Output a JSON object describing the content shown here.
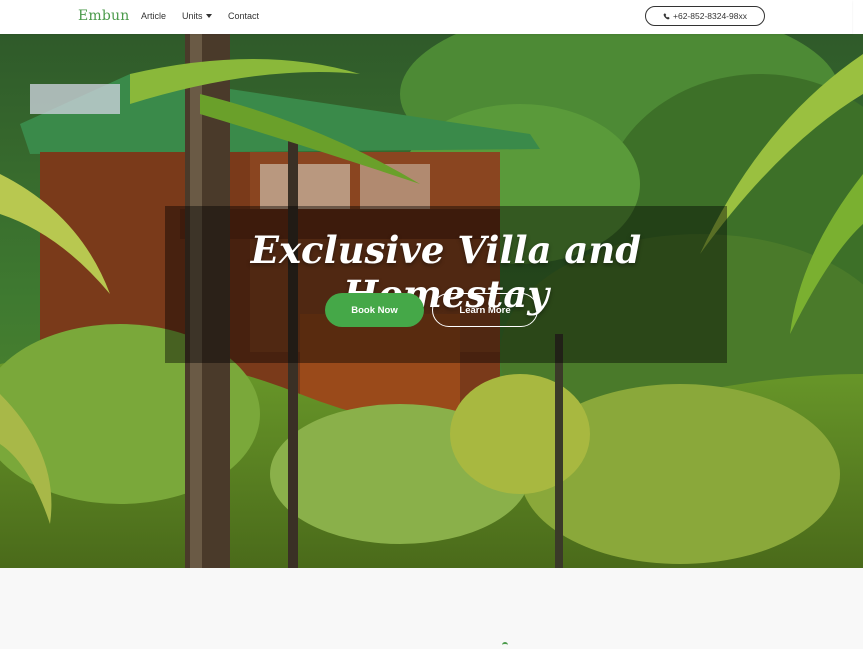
{
  "navbar": {
    "brand": "Embun",
    "links": [
      {
        "label": "Article"
      },
      {
        "label": "Units",
        "has_dropdown": true
      },
      {
        "label": "Contact"
      }
    ],
    "phone": {
      "label": "+62-852-8324-98xx",
      "icon": "phone-icon"
    }
  },
  "hero": {
    "title": "Exclusive Villa and Homestay",
    "primary_button": "Book Now",
    "secondary_button": "Learn More",
    "background_image": "tropical-villa-jungle-photo"
  },
  "colors": {
    "brand": "#4a9a4a",
    "primary_button": "#45a848",
    "overlay": "rgba(0,0,0,0.42)",
    "navbar_bg": "#ffffff"
  }
}
